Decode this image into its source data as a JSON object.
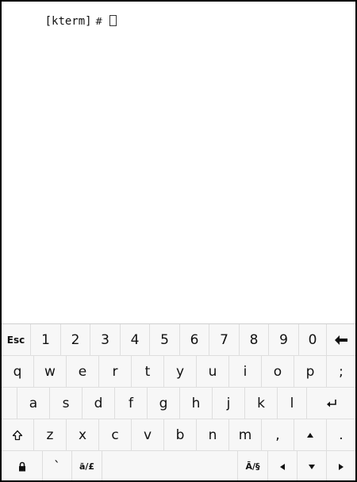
{
  "terminal": {
    "prompt_name": "kterm",
    "prompt_symbol": "#"
  },
  "keyboard": {
    "row1": [
      "Esc",
      "1",
      "2",
      "3",
      "4",
      "5",
      "6",
      "7",
      "8",
      "9",
      "0"
    ],
    "row2": [
      "q",
      "w",
      "e",
      "r",
      "t",
      "y",
      "u",
      "i",
      "o",
      "p",
      ";"
    ],
    "row3": [
      "a",
      "s",
      "d",
      "f",
      "g",
      "h",
      "j",
      "k",
      "l"
    ],
    "row4": [
      "z",
      "x",
      "c",
      "v",
      "b",
      "n",
      "m",
      ","
    ],
    "row4_period": ".",
    "row5": {
      "backtick": "`",
      "alt_left": "ā/£",
      "alt_right": "Ā/§"
    },
    "icons": {
      "backspace": "backspace-arrow-icon",
      "enter": "enter-return-icon",
      "shift": "shift-outline-icon",
      "caps": "lock-icon",
      "up": "arrow-up-icon",
      "left": "arrow-left-icon",
      "down": "arrow-down-icon",
      "right": "arrow-right-icon"
    }
  }
}
